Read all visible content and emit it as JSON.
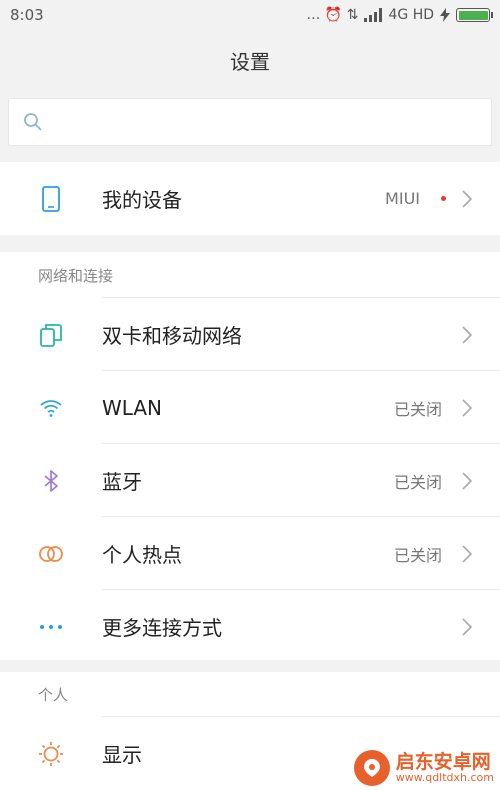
{
  "status_bar": {
    "time": "8:03",
    "indicators": "… ⏰ ⇅",
    "network": "4G HD",
    "icons": [
      "more-dots-icon",
      "alarm-icon",
      "data-transfer-icon",
      "signal-icon",
      "charging-icon",
      "battery-icon"
    ],
    "battery_level": 1.0
  },
  "header": {
    "title": "设置"
  },
  "search": {
    "placeholder": "",
    "icon": "search-icon"
  },
  "device": {
    "label": "我的设备",
    "value": "MIUI",
    "icon": "phone-icon",
    "icon_color": "#2d9be8",
    "dot_color": "#e53935"
  },
  "network_section": {
    "title": "网络和连接",
    "items": [
      {
        "label": "双卡和移动网络",
        "value": "",
        "icon": "dual-sim-icon",
        "icon_color": "#26b99a"
      },
      {
        "label": "WLAN",
        "value": "已关闭",
        "icon": "wifi-icon",
        "icon_color": "#2fa5e0"
      },
      {
        "label": "蓝牙",
        "value": "已关闭",
        "icon": "bluetooth-icon",
        "icon_color": "#a179d6"
      },
      {
        "label": "个人热点",
        "value": "已关闭",
        "icon": "hotspot-icon",
        "icon_color": "#f08a4b"
      },
      {
        "label": "更多连接方式",
        "value": "",
        "icon": "more-dots-icon",
        "icon_color": "#2d9be8"
      }
    ]
  },
  "personal_section": {
    "title": "个人",
    "items": [
      {
        "label": "显示",
        "value": "",
        "icon": "brightness-icon",
        "icon_color": "#f08a4b"
      }
    ]
  },
  "watermark": {
    "title": "启东安卓网",
    "url": "www.qdltdxh.com",
    "logo_color": "#e8612c"
  }
}
